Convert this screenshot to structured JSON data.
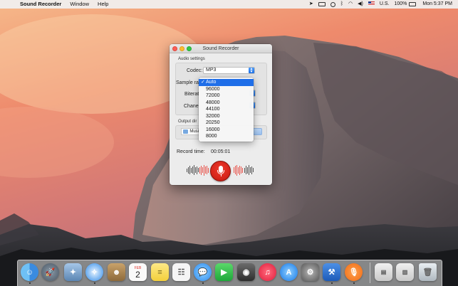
{
  "menubar": {
    "app_name": "Sound Recorder",
    "items": [
      "Window",
      "Help"
    ],
    "status": {
      "input_source": "U.S.",
      "battery": "100%",
      "clock": "Mon 5:37 PM"
    }
  },
  "window": {
    "title": "Sound Recorder",
    "audio_settings_label": "Audio settings",
    "codec_label": "Codec:",
    "codec_value": "MP3",
    "sample_rate_label": "Sample rat",
    "bitrate_label": "Biterat",
    "channel_label": "Chanel",
    "output_dir_label": "Output dir",
    "output_dir_value": "Musi",
    "record_time_label": "Record time:",
    "record_time_value": "00:05:01"
  },
  "sample_rate_menu": {
    "selected": "Auto",
    "options": [
      "Auto",
      "96000",
      "72000",
      "48000",
      "44100",
      "32000",
      "20250",
      "16000",
      "8000"
    ]
  },
  "dock": {
    "apps": [
      "finder",
      "launchpad",
      "preview",
      "safari",
      "contacts",
      "calendar",
      "notes",
      "reminders",
      "messages",
      "facetime",
      "photo-booth",
      "itunes",
      "app-store",
      "system-preferences",
      "xcode",
      "sound-recorder",
      "downloads",
      "documents",
      "trash"
    ],
    "calendar_month": "FEB",
    "calendar_day": "2"
  },
  "colors": {
    "accent": "#1f6ee8",
    "record_red": "#d52419",
    "wave_red": "#e8574f"
  }
}
